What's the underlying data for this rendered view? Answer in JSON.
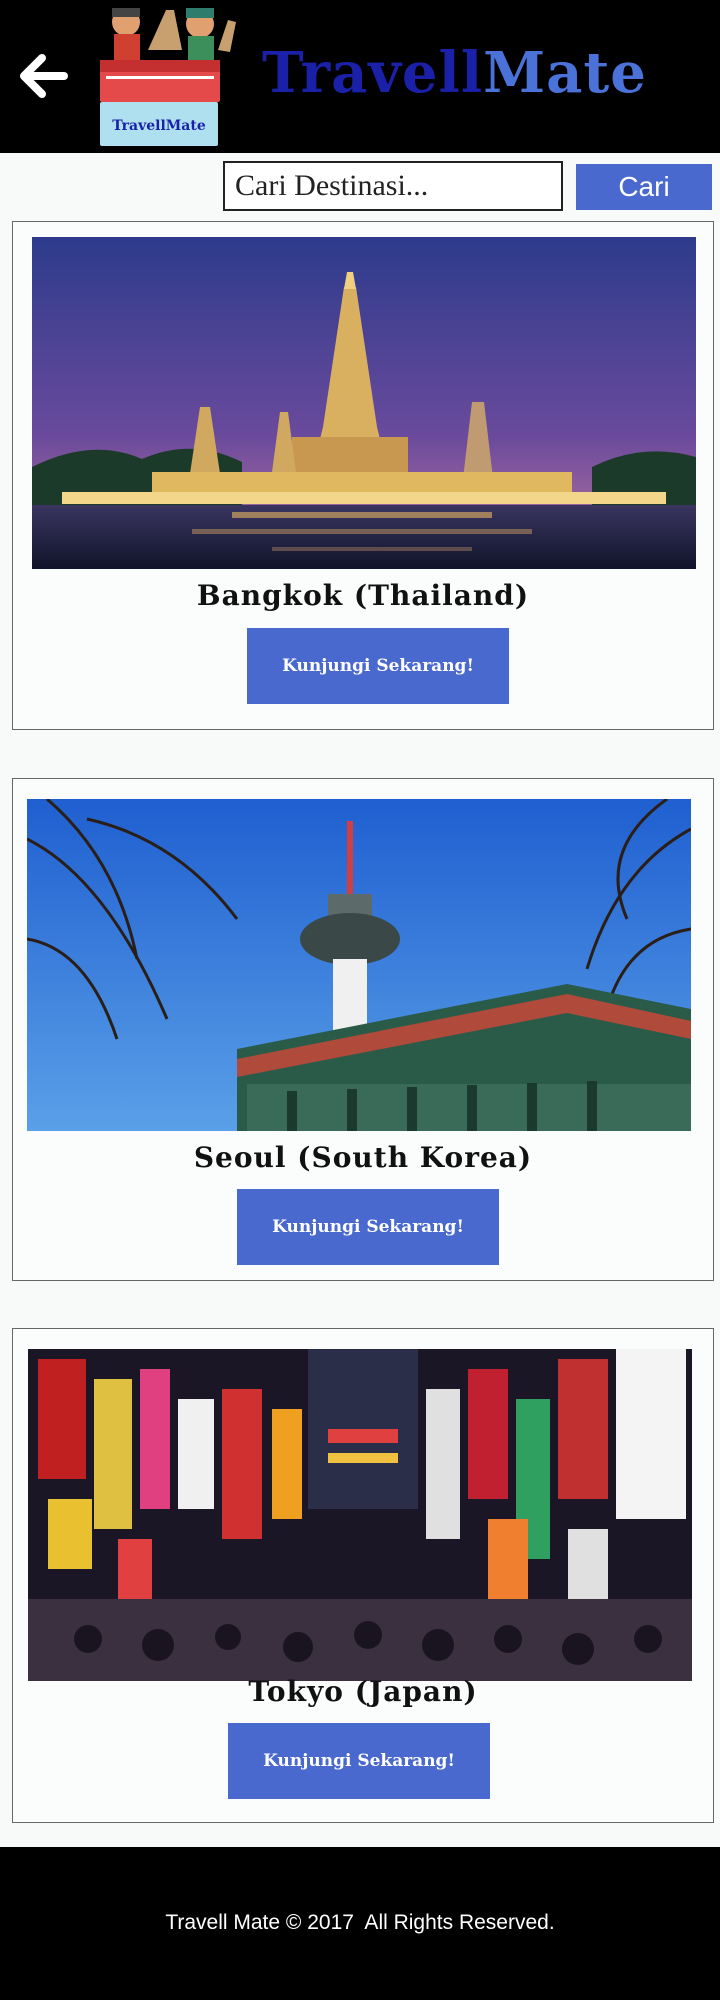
{
  "header": {
    "back_icon": "arrow-left-icon",
    "logo_text": "TravellMate",
    "brand_part1": "Travell",
    "brand_part2": "Mate",
    "brand_colors": [
      "#1a21a8",
      "#4a72d8"
    ]
  },
  "search": {
    "placeholder": "Cari Destinasi...",
    "button_label": "Cari"
  },
  "destinations": [
    {
      "name": "Bangkok (Thailand)",
      "button_label": "Kunjungi Sekarang!",
      "image": "bangkok-temple-photo"
    },
    {
      "name": "Seoul (South Korea)",
      "button_label": "Kunjungi Sekarang!",
      "image": "seoul-tower-photo"
    },
    {
      "name": "Tokyo (Japan)",
      "button_label": "Kunjungi Sekarang!",
      "image": "tokyo-street-photo"
    }
  ],
  "footer": {
    "text": "Travell Mate © 2017  All Rights Reserved."
  },
  "colors": {
    "accent": "#4a69cf",
    "header_bg": "#000000"
  }
}
